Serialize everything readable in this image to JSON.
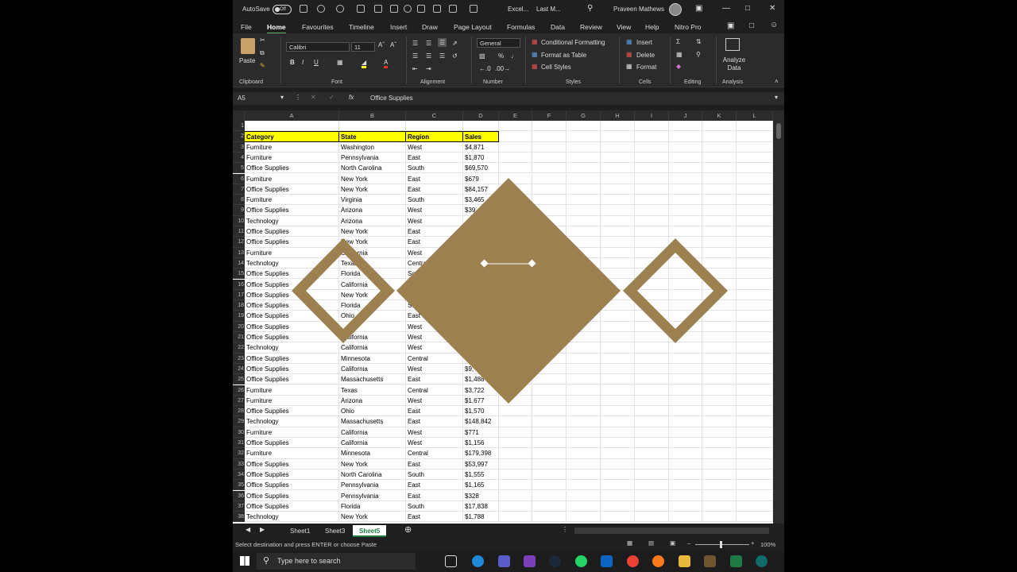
{
  "titlebar": {
    "autosave": "AutoSave",
    "toggle": "Off",
    "file_label": "Excel...",
    "last_modified": "Last M...",
    "user": "Praveen Mathews"
  },
  "menu": [
    "File",
    "Home",
    "Favourites",
    "Timeline",
    "Insert",
    "Draw",
    "Page Layout",
    "Formulas",
    "Data",
    "Review",
    "View",
    "Help",
    "Nitro Pro"
  ],
  "ribbon": {
    "paste": "Paste",
    "font_name": "Calibri",
    "font_size": "11",
    "number_format": "General",
    "conditional_formatting": "Conditional Formatting",
    "format_as_table": "Format as Table",
    "cell_styles": "Cell Styles",
    "insert": "Insert",
    "delete": "Delete",
    "format": "Format",
    "analyze_data": "Analyze Data",
    "groups": [
      "Clipboard",
      "Font",
      "Alignment",
      "Number",
      "Styles",
      "Cells",
      "Editing",
      "Analysis"
    ]
  },
  "formula_bar": {
    "name_box": "A5",
    "formula": "Office Supplies"
  },
  "columns": [
    "A",
    "B",
    "C",
    "D",
    "E",
    "F",
    "G",
    "H",
    "I",
    "J",
    "K",
    "L"
  ],
  "header_row": [
    "Category",
    "State",
    "Region",
    "Sales"
  ],
  "rows": [
    [
      "Furniture",
      "Washington",
      "West",
      "$4,871"
    ],
    [
      "Furniture",
      "Pennsylvania",
      "East",
      "$1,870"
    ],
    [
      "Office Supplies",
      "North Carolina",
      "South",
      "$69,570"
    ],
    [
      "Furniture",
      "New York",
      "East",
      "$679"
    ],
    [
      "Office Supplies",
      "New York",
      "East",
      "$84,157"
    ],
    [
      "Furniture",
      "Virginia",
      "South",
      "$3,465"
    ],
    [
      "Office Supplies",
      "Arizona",
      "West",
      "$39"
    ],
    [
      "Technology",
      "Arizona",
      "West",
      ""
    ],
    [
      "Office Supplies",
      "New York",
      "East",
      ""
    ],
    [
      "Office Supplies",
      "New York",
      "East",
      ""
    ],
    [
      "Furniture",
      "California",
      "West",
      ""
    ],
    [
      "Technology",
      "Texas",
      "Central",
      ""
    ],
    [
      "Office Supplies",
      "Florida",
      "South",
      ""
    ],
    [
      "Office Supplies",
      "California",
      "West",
      ""
    ],
    [
      "Office Supplies",
      "New York",
      "East",
      ""
    ],
    [
      "Office Supplies",
      "Florida",
      "South",
      ""
    ],
    [
      "Office Supplies",
      "Ohio",
      "East",
      ""
    ],
    [
      "Office Supplies",
      "",
      "West",
      ""
    ],
    [
      "Office Supplies",
      "California",
      "West",
      ""
    ],
    [
      "Technology",
      "California",
      "West",
      ""
    ],
    [
      "Office Supplies",
      "Minnesota",
      "Central",
      ""
    ],
    [
      "Office Supplies",
      "California",
      "West",
      "$9,"
    ],
    [
      "Office Supplies",
      "Massachusetts",
      "East",
      "$1,488"
    ],
    [
      "Furniture",
      "Texas",
      "Central",
      "$3,722"
    ],
    [
      "Furniture",
      "Arizona",
      "West",
      "$1,677"
    ],
    [
      "Office Supplies",
      "Ohio",
      "East",
      "$1,570"
    ],
    [
      "Technology",
      "Massachusetts",
      "East",
      "$148,842"
    ],
    [
      "Furniture",
      "California",
      "West",
      "$771"
    ],
    [
      "Office Supplies",
      "California",
      "West",
      "$1,156"
    ],
    [
      "Furniture",
      "Minnesota",
      "Central",
      "$179,398"
    ],
    [
      "Office Supplies",
      "New York",
      "East",
      "$53,997"
    ],
    [
      "Office Supplies",
      "North Carolina",
      "South",
      "$1,555"
    ],
    [
      "Office Supplies",
      "Pennsylvania",
      "East",
      "$1,165"
    ],
    [
      "Office Supplies",
      "Pennsylvania",
      "East",
      "$328"
    ],
    [
      "Office Supplies",
      "Florida",
      "South",
      "$17,838"
    ],
    [
      "Technology",
      "New York",
      "East",
      "$1,788"
    ]
  ],
  "sheet_tabs": [
    "Sheet1",
    "Sheet3",
    "Sheet5"
  ],
  "status": {
    "message": "Select destination and press ENTER or choose Paste",
    "zoom": "100%"
  },
  "taskbar": {
    "search_placeholder": "Type here to search"
  },
  "overlay_color": "#9c8050"
}
